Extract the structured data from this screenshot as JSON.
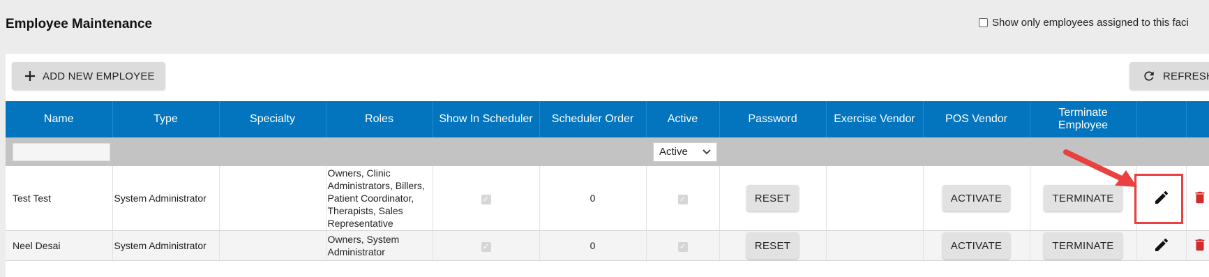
{
  "page": {
    "title": "Employee Maintenance",
    "facility_filter_label": "Show only employees assigned to this faci",
    "facility_filter_checked": false
  },
  "toolbar": {
    "add_label": "ADD NEW EMPLOYEE",
    "add_icon": "plus-icon",
    "refresh_label": "REFRESH",
    "refresh_icon": "refresh-icon"
  },
  "table": {
    "columns": [
      "Name",
      "Type",
      "Specialty",
      "Roles",
      "Show In Scheduler",
      "Scheduler Order",
      "Active",
      "Password",
      "Exercise Vendor",
      "POS Vendor",
      "Terminate Employee",
      "",
      ""
    ],
    "filters": {
      "name_value": "",
      "active_value": "Active"
    },
    "rows": [
      {
        "name": "Test Test",
        "type": "System Administrator",
        "specialty": "",
        "roles": "Owners, Clinic Administrators, Billers, Patient Coordinator, Therapists, Sales Representative",
        "show_in_scheduler": true,
        "scheduler_order": "0",
        "active": true,
        "password_btn": "RESET",
        "exercise_vendor": "",
        "pos_vendor_btn": "ACTIVATE",
        "terminate_btn": "TERMINATE"
      },
      {
        "name": "Neel Desai",
        "type": "System Administrator",
        "specialty": "",
        "roles": "Owners, System Administrator",
        "show_in_scheduler": true,
        "scheduler_order": "0",
        "active": true,
        "password_btn": "RESET",
        "exercise_vendor": "",
        "pos_vendor_btn": "ACTIVATE",
        "terminate_btn": "TERMINATE"
      }
    ]
  },
  "colors": {
    "header_bg": "#0275be",
    "delete_icon": "#d42a2a",
    "annotation": "#ea4040"
  }
}
